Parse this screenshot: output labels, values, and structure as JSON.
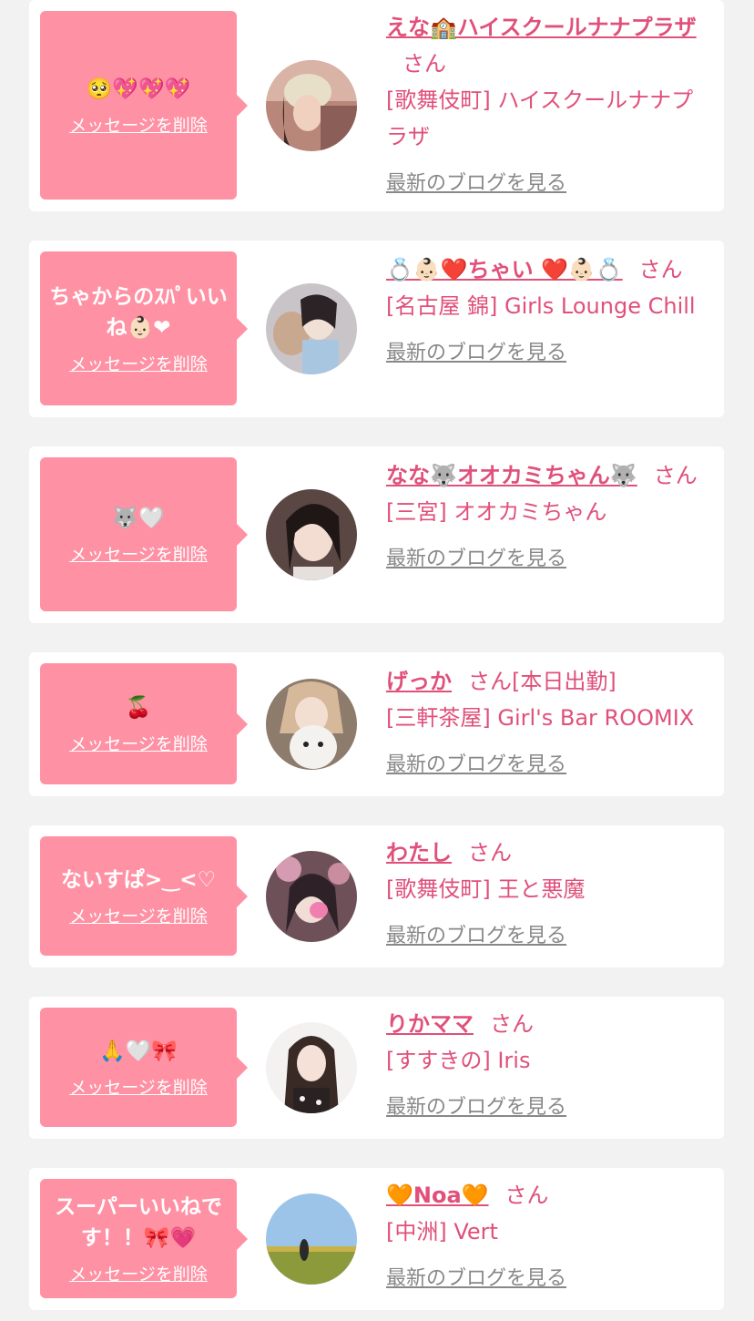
{
  "colors": {
    "background": "#f2f2f2",
    "card": "#ffffff",
    "bubble": "#ff91a4",
    "accent_text": "#e0507a",
    "link_gray": "#888888"
  },
  "cards": [
    {
      "message": "🥺💖💖💖",
      "delete_label": "メッセージを削除",
      "name": "えな🏫ハイスクールナナプラザ",
      "honorific": "さん",
      "status": "",
      "shop": "[歌舞伎町] ハイスクールナナプラザ",
      "blog_label": "最新のブログを見る",
      "avatar_icon": "avatar-photo"
    },
    {
      "message": "ちゃからのｽﾊﾟいいね👶🏻❤",
      "delete_label": "メッセージを削除",
      "name": "💍👶🏻❤️ちゃい ❤️👶🏻💍",
      "honorific": "さん",
      "status": "",
      "shop": "[名古屋 錦] Girls Lounge Chill",
      "blog_label": "最新のブログを見る",
      "avatar_icon": "avatar-photo"
    },
    {
      "message": "🐺🤍",
      "delete_label": "メッセージを削除",
      "name": "なな🐺オオカミちゃん🐺",
      "honorific": "さん",
      "status": "",
      "shop": "[三宮] オオカミちゃん",
      "blog_label": "最新のブログを見る",
      "avatar_icon": "avatar-photo"
    },
    {
      "message": "🍒",
      "delete_label": "メッセージを削除",
      "name": "げっか",
      "honorific": "さん",
      "status": "[本日出勤]",
      "shop": "[三軒茶屋] Girl's Bar ROOMIX",
      "blog_label": "最新のブログを見る",
      "avatar_icon": "avatar-photo"
    },
    {
      "message": "ないすぱ>‿<♡",
      "delete_label": "メッセージを削除",
      "name": "わたし",
      "honorific": "さん",
      "status": "",
      "shop": "[歌舞伎町] 王と悪魔",
      "blog_label": "最新のブログを見る",
      "avatar_icon": "avatar-photo"
    },
    {
      "message": "🙏🤍🎀",
      "delete_label": "メッセージを削除",
      "name": "りかママ",
      "honorific": "さん",
      "status": "",
      "shop": "[すすきの] Iris",
      "blog_label": "最新のブログを見る",
      "avatar_icon": "avatar-photo"
    },
    {
      "message": "スーパーいいねです！！🎀💗",
      "delete_label": "メッセージを削除",
      "name": "🧡Noa🧡",
      "honorific": "さん",
      "status": "",
      "shop": "[中洲] Vert",
      "blog_label": "最新のブログを見る",
      "avatar_icon": "avatar-photo"
    }
  ]
}
